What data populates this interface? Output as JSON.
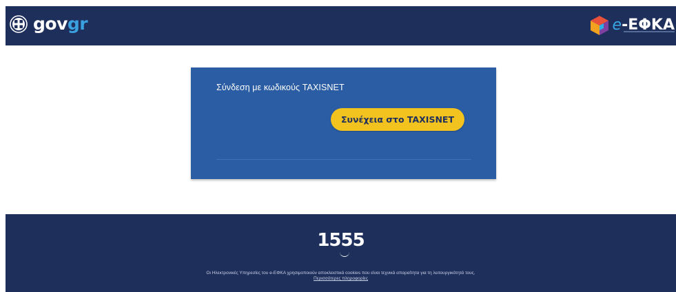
{
  "header": {
    "gov_logo": {
      "part1": "gov",
      "part2": "gr"
    },
    "efka_logo": {
      "e": "e",
      "text": "-ΕΦΚΑ"
    }
  },
  "login_card": {
    "title": "Σύνδεση με κωδικούς TAXISNET",
    "button_label": "Συνέχεια στο TAXISNET"
  },
  "footer": {
    "phone": "1555",
    "cookie_notice": "Οι Ηλεκτρονικές Υπηρεσίες του e-ΕΦΚΑ χρησιμοποιούν αποκλειστικά cookies που είναι τεχνικά απαραίτητα για τη λειτουργικότητά τους.",
    "more_info_link": "Περισσότερες πληροφορίες"
  },
  "colors": {
    "header_bg": "#1f2f5c",
    "card_bg": "#2a5da4",
    "button_bg": "#f2c21f",
    "gov_accent": "#3aa0e0"
  },
  "icons": {
    "gov_emblem": "greek-coat-of-arms-icon",
    "efka_mark": "efka-cube-logo-icon"
  }
}
